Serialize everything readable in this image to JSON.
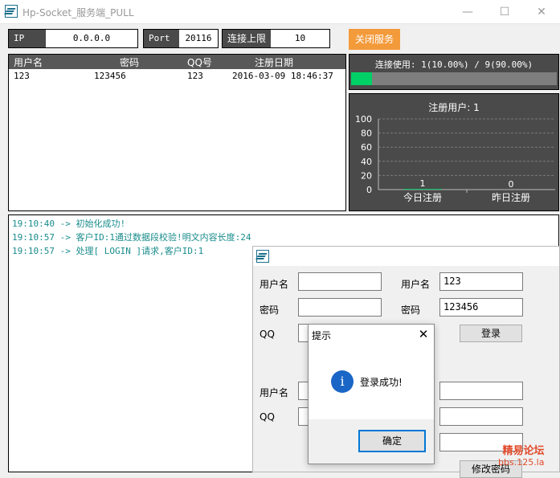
{
  "window": {
    "title": "Hp-Socket_服务端_PULL"
  },
  "server": {
    "ip_label": "IP",
    "ip_value": "0.0.0.0",
    "port_label": "Port",
    "port_value": "20116",
    "limit_label": "连接上限",
    "limit_value": "10",
    "stop_label": "关闭服务"
  },
  "table": {
    "headers": [
      "用户名",
      "密码",
      "QQ号",
      "注册日期"
    ],
    "rows": [
      {
        "user": "123",
        "password": "123456",
        "qq": "123",
        "date": "2016-03-09 18:46:37"
      }
    ]
  },
  "connection": {
    "text": "连接使用: 1(10.00%) / 9(90.00%)",
    "percent": 10,
    "fill_color": "#00d066"
  },
  "chart_data": {
    "type": "bar",
    "title": "注册用户: 1",
    "categories": [
      "今日注册",
      "昨日注册"
    ],
    "values": [
      1,
      0
    ],
    "data_labels": [
      "1",
      "0"
    ],
    "ylim": [
      0,
      100
    ],
    "yticks": [
      0,
      20,
      40,
      60,
      80,
      100
    ],
    "grid": true,
    "bar_color": "#00d066"
  },
  "log": [
    "19:10:40 -> 初始化成功!",
    "19:10:57 -> 客户ID:1通过数据段校验!明文内容长度:24",
    "19:10:57 -> 处理[ LOGIN ]请求,客户ID:1"
  ],
  "client": {
    "left": {
      "user_label": "用户名",
      "password_label": "密码",
      "qq_label": "QQ",
      "user_value": "",
      "password_value": "",
      "qq_value": ""
    },
    "login": {
      "user_label": "用户名",
      "password_label": "密码",
      "user_value": "123",
      "password_value": "123456",
      "login_label": "登录"
    },
    "bottom": {
      "user_label": "用户名",
      "qq_label": "QQ",
      "change_password_label": "修改密码"
    }
  },
  "dialog": {
    "title": "提示",
    "icon": "info-icon",
    "message": "登录成功!",
    "ok_label": "确定"
  },
  "watermark": {
    "line1": "精易论坛",
    "line2": "bbs.125.la"
  }
}
